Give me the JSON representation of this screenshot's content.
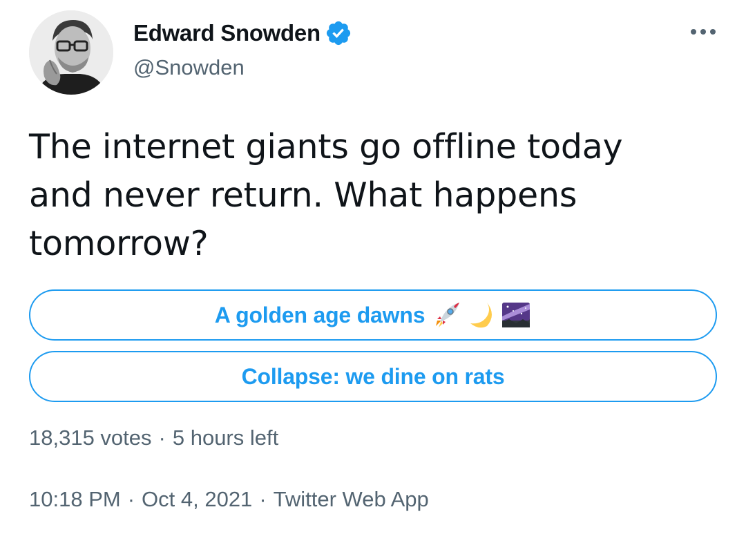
{
  "author": {
    "display_name": "Edward Snowden",
    "handle": "@Snowden",
    "verified": true,
    "avatar_icon": "profile-photo"
  },
  "menu": {
    "more_icon": "more-options-icon"
  },
  "tweet": {
    "text": "The internet giants go offline today\nand never return. What happens\ntomorrow?"
  },
  "poll": {
    "options": [
      {
        "label": "A golden age dawns",
        "emojis": [
          "rocket",
          "crescent-moon",
          "milky-way"
        ]
      },
      {
        "label": "Collapse: we dine on rats"
      }
    ],
    "votes": "18,315 votes",
    "separator": "·",
    "time_left": "5 hours left"
  },
  "meta": {
    "time": "10:18 PM",
    "date": "Oct 4, 2021",
    "source": "Twitter Web App",
    "separator": "·"
  },
  "colors": {
    "accent": "#1d9bf0",
    "text": "#0f1419",
    "secondary": "#536471"
  }
}
